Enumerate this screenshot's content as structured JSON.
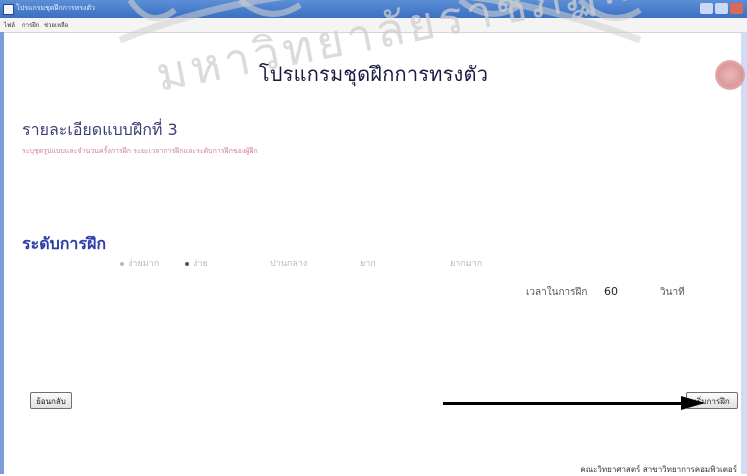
{
  "window": {
    "title": "โปรแกรมชุดฝึกการทรงตัว"
  },
  "menu": {
    "items": [
      "ไฟล์",
      "การฝึก",
      "ช่วยเหลือ"
    ]
  },
  "main": {
    "title": "โปรแกรมชุดฝึกการทรงตัว",
    "section_heading": "รายละเอียดแบบฝึกที่ 3",
    "instruction": "ระบุชุดรูปแบบและจำนวนครั้งการฝึก ระยะเวลาการฝึกและระดับการฝึกของผู้ฝึก"
  },
  "level": {
    "heading": "ระดับการฝึก",
    "options": [
      "ง่ายมาก",
      "ง่าย",
      "ปานกลาง",
      "ยาก",
      "ยากมาก"
    ],
    "selected": "ง่าย"
  },
  "timer": {
    "label": "เวลาในการฝึก",
    "value": "60",
    "unit": "วินาที"
  },
  "buttons": {
    "back": "ย้อนกลับ",
    "start": "เริ่มการฝึก"
  },
  "footer": {
    "text": "คณะวิทยาศาสตร์ สาขาวิทยาการคอมพิวเตอร์"
  },
  "watermark": {
    "text": "มหาวิทยาลัยราชภัฏพระจอมเกล้าเจ้าคุณ"
  }
}
